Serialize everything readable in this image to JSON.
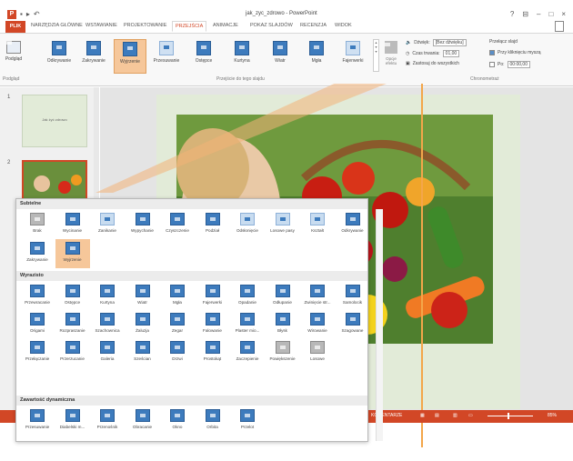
{
  "window": {
    "title": "jak_zyc_zdrowo - PowerPoint",
    "controls": [
      "?",
      "⊟",
      "–",
      "□",
      "×"
    ]
  },
  "tabs": [
    {
      "label": "PLIK",
      "active": false
    },
    {
      "label": "NARZĘDZIA GŁÓWNE",
      "active": false
    },
    {
      "label": "WSTAWIANIE",
      "active": false
    },
    {
      "label": "PROJEKTOWANIE",
      "active": false
    },
    {
      "label": "PRZEJŚCIA",
      "active": true
    },
    {
      "label": "ANIMACJE",
      "active": false
    },
    {
      "label": "POKAZ SLAJDÓW",
      "active": false
    },
    {
      "label": "RECENZJA",
      "active": false
    },
    {
      "label": "WIDOK",
      "active": false
    }
  ],
  "ribbon": {
    "preview_label": "Podgląd",
    "preview_group": "Podgląd",
    "transitions_group": "Przejście do tego slajdu",
    "timing_group": "Chronometraż",
    "options_label": "Opcje efektu",
    "buttons": [
      "Odkrywanie",
      "Zakrywanie",
      "Wyjrzenie",
      "Przesuwanie",
      "Ostępce",
      "Kurtyna",
      "Wiatr",
      "Mgła",
      "Fajerwerki"
    ],
    "selected_button": "Wyjrzenie",
    "timing": {
      "sound_label": "Dźwięk:",
      "sound_value": "[Bez dźwięku]",
      "duration_label": "Czas trwania:",
      "duration_value": "01,00",
      "apply_all": "Zastosuj do wszystkich",
      "advance_label": "Przełącz slajd",
      "on_click": "Przy kliknięciu myszą",
      "after_label": "Po:",
      "after_value": "00:00,00"
    }
  },
  "slides": {
    "items": [
      {
        "number": "1",
        "thumb_text": "Jak żyć zdrowo"
      },
      {
        "number": "2"
      }
    ]
  },
  "gallery": {
    "sections": [
      {
        "title": "Subtelne",
        "items": [
          "Brak",
          "Wycinanie",
          "Zanikanie",
          "Wypychanie",
          "Czyszczenie",
          "Podział",
          "Odsłonięcie",
          "Losowe pasy",
          "Kształt",
          "Odkrywanie",
          "Zakrywanie",
          "Wyjrzenie"
        ]
      },
      {
        "title": "Wyrazisto",
        "items": [
          "Przewracanie",
          "Ostępce",
          "Kurtyna",
          "Wiatr",
          "Mgła",
          "Fajerwerki",
          "Opadanie",
          "Odłupanie",
          "Zwinięcie str...",
          "Samolocik",
          "Origami",
          "Rozpraszanie",
          "Szachownica",
          "Żaluzja",
          "Zegar",
          "Falowanie",
          "Plaster mio...",
          "Błysk",
          "Wirowanie",
          "Szagowane",
          "Przełączanie",
          "Przerzucanie",
          "Galeria",
          "Sześcian",
          "Drzwi",
          "Prostokąt",
          "Zaczepienie",
          "Powiększenie",
          "Losowe"
        ]
      },
      {
        "title": "Zawartość dynamiczna",
        "items": [
          "Przesuwanie",
          "Diabelski m...",
          "Przenośnik",
          "Obracanie",
          "Okno",
          "Orbita",
          "Przelot"
        ]
      }
    ],
    "selected": "Wyjrzenie"
  },
  "status": {
    "notes": "KOMENTARZE",
    "zoom": "85%"
  },
  "colors": {
    "accent": "#d24726",
    "highlight": "#f6c79a",
    "icon_blue": "#3d7bbd",
    "slide_bg": "#e2ebd8"
  }
}
